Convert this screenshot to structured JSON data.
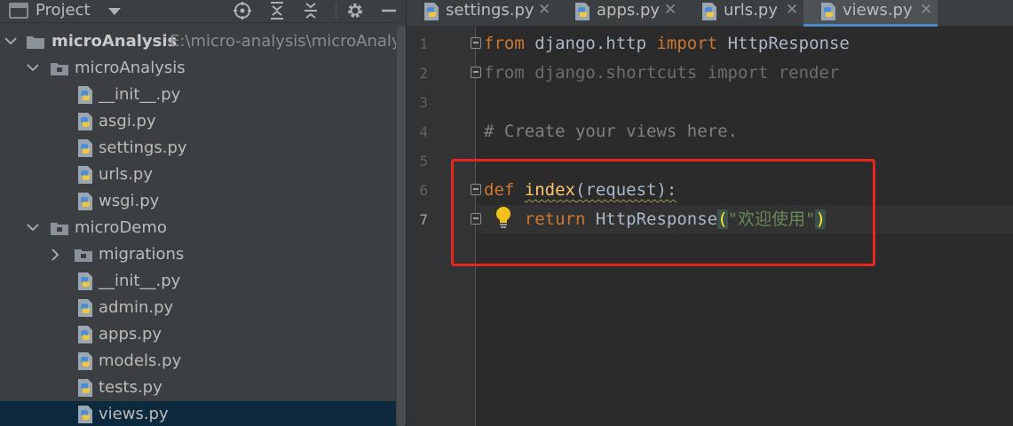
{
  "project_panel": {
    "title": "Project",
    "tree": [
      {
        "label": "microAnalysis",
        "path": "E:\\micro-analysis\\microAnalysis"
      },
      {
        "label": "microAnalysis"
      },
      {
        "label": "__init__.py"
      },
      {
        "label": "asgi.py"
      },
      {
        "label": "settings.py"
      },
      {
        "label": "urls.py"
      },
      {
        "label": "wsgi.py"
      },
      {
        "label": "microDemo"
      },
      {
        "label": "migrations"
      },
      {
        "label": "__init__.py"
      },
      {
        "label": "admin.py"
      },
      {
        "label": "apps.py"
      },
      {
        "label": "models.py"
      },
      {
        "label": "tests.py"
      },
      {
        "label": "views.py"
      }
    ]
  },
  "editor": {
    "tabs": [
      {
        "label": "settings.py",
        "active": false
      },
      {
        "label": "apps.py",
        "active": false
      },
      {
        "label": "urls.py",
        "active": false
      },
      {
        "label": "views.py",
        "active": true
      }
    ],
    "line_numbers": [
      "1",
      "2",
      "3",
      "4",
      "5",
      "6",
      "7"
    ],
    "code": {
      "line1": {
        "kw1": "from",
        "mod": " django.http ",
        "kw2": "import",
        "name": " HttpResponse"
      },
      "line2": "from django.shortcuts import render",
      "line4": "# Create your views here.",
      "line6": {
        "kw": "def",
        "fn": "index",
        "rest": "(request):"
      },
      "line7": {
        "kw": "return",
        "call": " HttpResponse",
        "open": "(",
        "str": "\"欢迎使用\"",
        "close": ")"
      }
    }
  },
  "colors": {
    "highlight_box": "#e8261e",
    "keyword": "#cc7832",
    "function": "#ffc66d",
    "string": "#6a8759"
  }
}
